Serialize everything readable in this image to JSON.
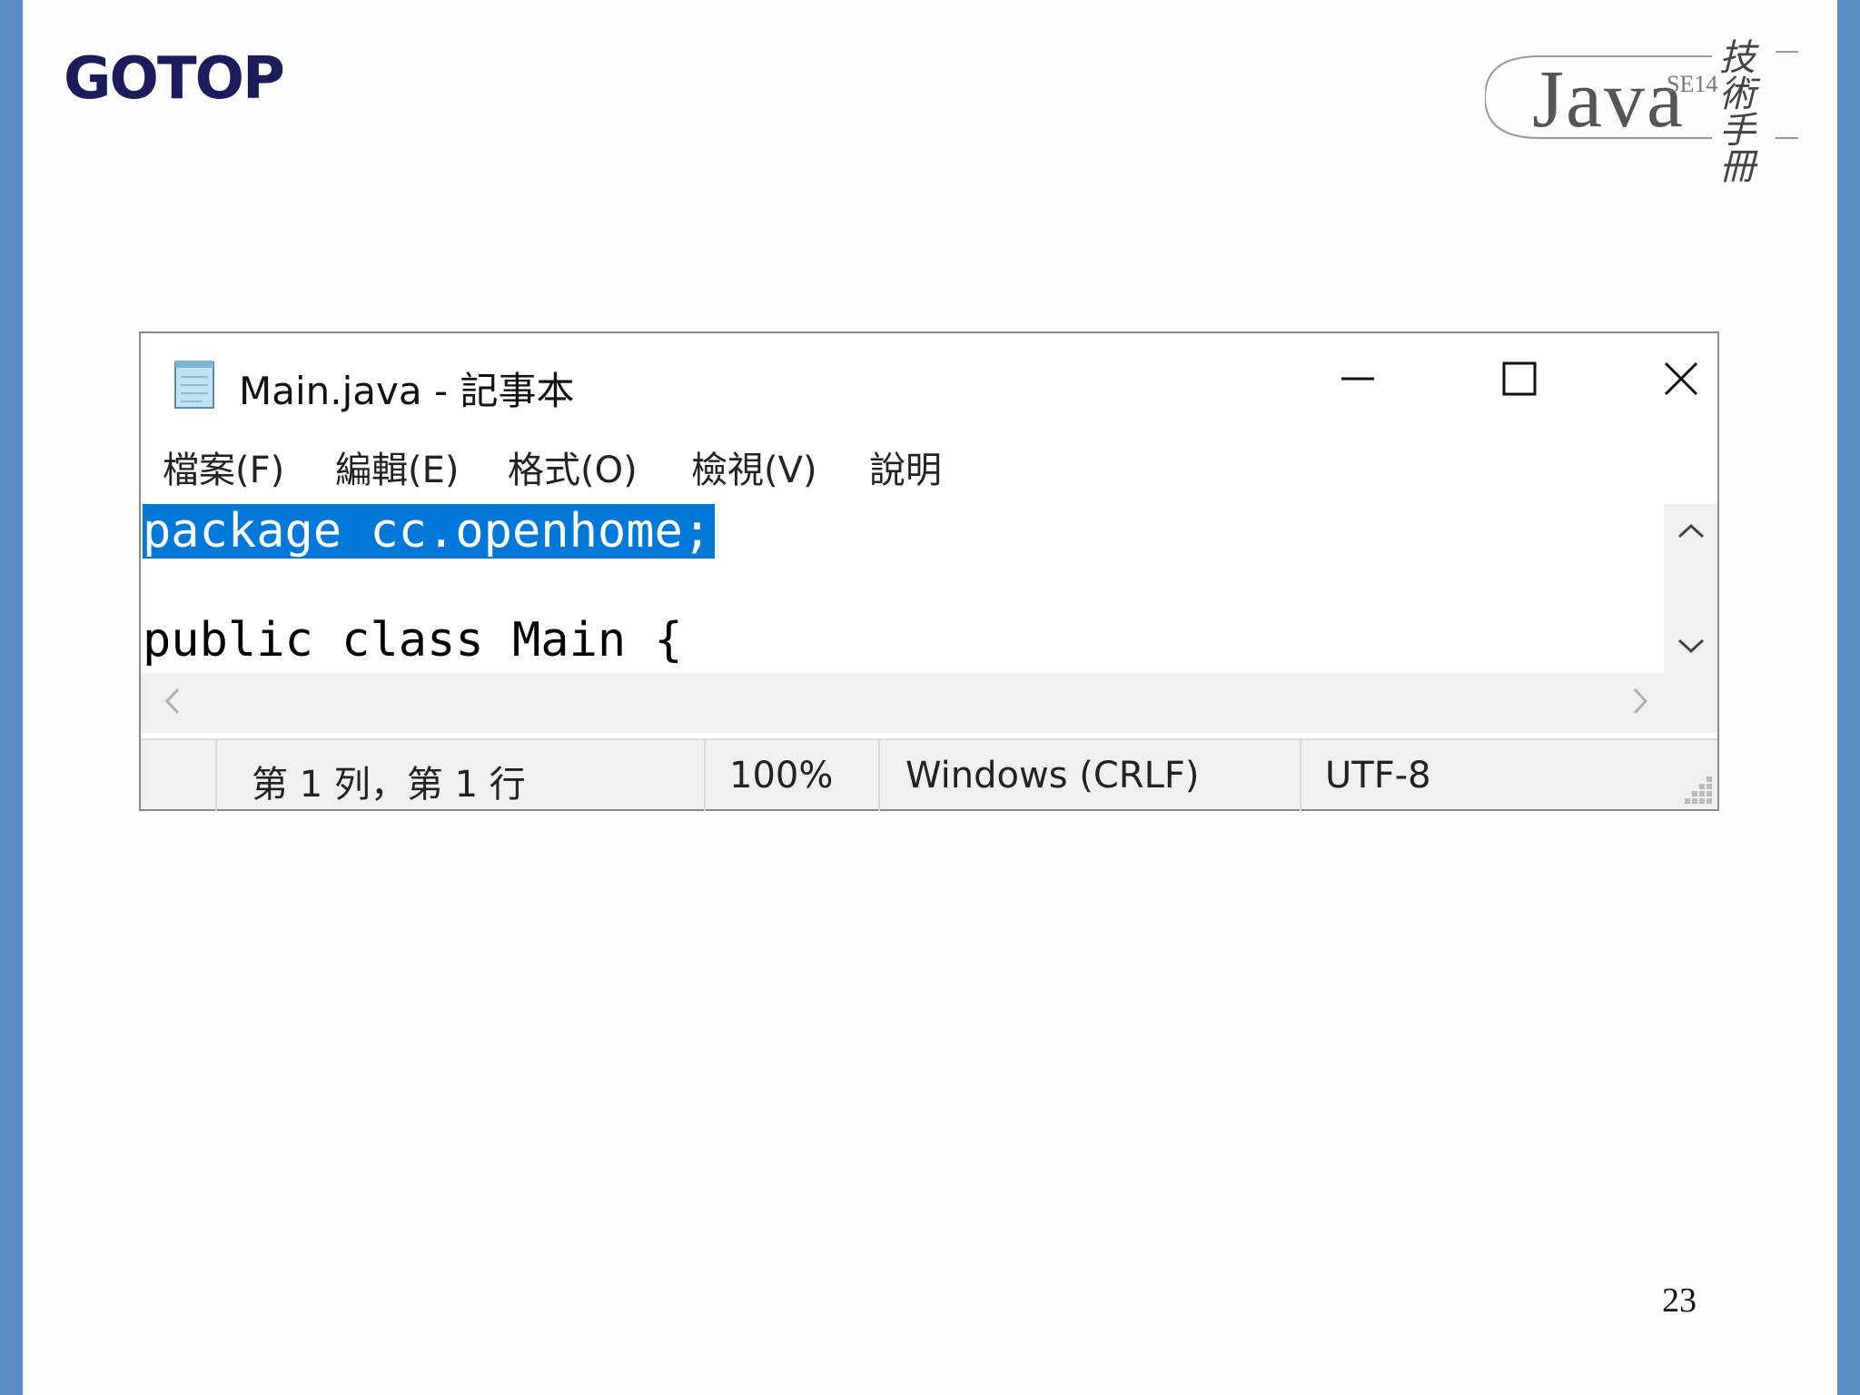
{
  "slide": {
    "publisher_logo": "GOTOP",
    "book_logo": {
      "word": "Java",
      "edition": "SE14",
      "cjk": "技術手冊"
    },
    "page_number": "23"
  },
  "window": {
    "title": "Main.java - 記事本",
    "app_icon": "notepad-icon",
    "controls": {
      "minimize": "—",
      "maximize": "☐",
      "close": "✕"
    }
  },
  "menu": {
    "items": [
      "檔案(F)",
      "編輯(E)",
      "格式(O)",
      "檢視(V)",
      "說明"
    ]
  },
  "editor": {
    "lines": [
      "package cc.openhome;",
      "",
      "public class Main {"
    ],
    "selected_line": 0
  },
  "scrollbars": {
    "up_icon": "chevron-up-icon",
    "down_icon": "chevron-down-icon",
    "left_icon": "chevron-left-icon",
    "right_icon": "chevron-right-icon"
  },
  "status": {
    "position": "第 1 列，第 1 行",
    "zoom": "100%",
    "line_ending": "Windows (CRLF)",
    "encoding": "UTF-8"
  },
  "colors": {
    "slide_bar": "#5b8ec4",
    "selection": "#0078d7",
    "publisher_logo": "#1a1d5a"
  }
}
